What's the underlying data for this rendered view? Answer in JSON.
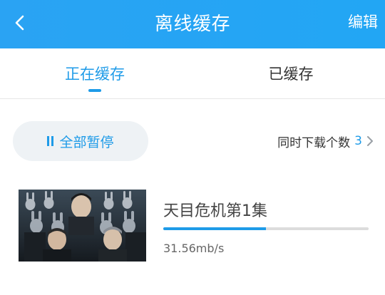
{
  "header": {
    "title": "离线缓存",
    "edit_label": "编辑",
    "back_icon": "chevron-left-icon",
    "background": "#22a6f4"
  },
  "tabs": [
    {
      "label": "正在缓存",
      "active": true
    },
    {
      "label": "已缓存",
      "active": false
    }
  ],
  "controls": {
    "pause_all_label": "全部暂停",
    "pause_icon": "pause-icon",
    "concurrency_label": "同时下载个数",
    "concurrency_value": "3",
    "concurrency_icon": "chevron-right-icon"
  },
  "downloads": [
    {
      "title": "天目危机第1集",
      "speed": "31.56mb/s",
      "progress": 0.5
    }
  ],
  "colors": {
    "accent": "#1e9be8",
    "pause_bg": "#eef2f5"
  }
}
